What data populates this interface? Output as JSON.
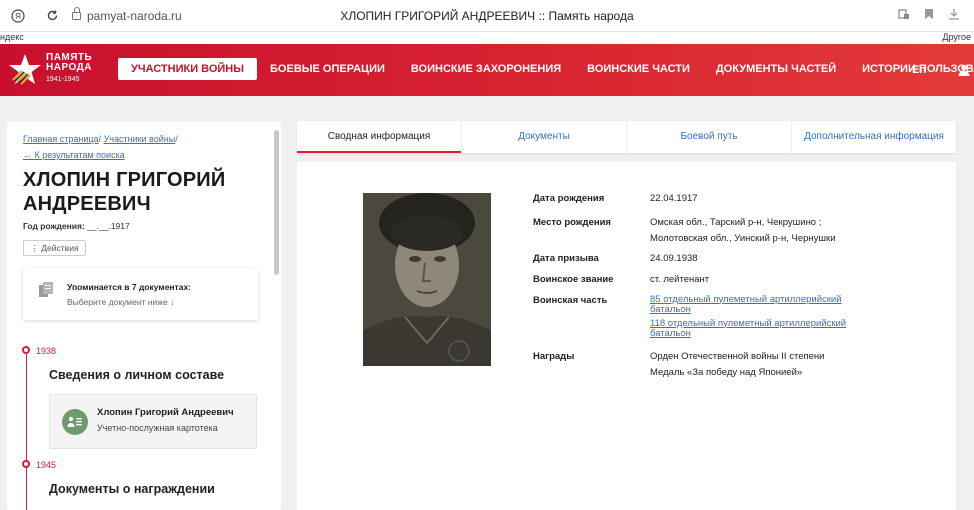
{
  "browser": {
    "url": "pamyat-naroda.ru",
    "page_title": "ХЛОПИН ГРИГОРИЙ АНДРЕЕВИЧ :: Память народа",
    "bookmark_left": "ндекс",
    "bookmark_right": "Другое"
  },
  "logo": {
    "line1": "ПАМЯТЬ",
    "line2": "НАРОДА",
    "line3": "1941-1945"
  },
  "nav": {
    "items": [
      "УЧАСТНИКИ ВОЙНЫ",
      "БОЕВЫЕ ОПЕРАЦИИ",
      "ВОИНСКИЕ ЗАХОРОНЕНИЯ",
      "ВОИНСКИЕ ЧАСТИ",
      "ДОКУМЕНТЫ ЧАСТЕЙ",
      "ИСТОРИИ ПОЛЬЗОВАТЕЛЕЙ"
    ],
    "lang": "En"
  },
  "sidebar": {
    "crumb_home": "Главная страница",
    "crumb_participants": "Участники войны",
    "back": "← К результатам поиска",
    "name": "ХЛОПИН ГРИГОРИЙ АНДРЕЕВИЧ",
    "birth_year_label": "Год рождения:",
    "birth_year_value": "__.__.1917",
    "actions": "⋮ Действия",
    "mention_title": "Упоминается в 7 документах:",
    "mention_sub": "Выберите документ ниже ↓",
    "timeline": [
      {
        "year": "1938",
        "heading": "Сведения о личном составе"
      },
      {
        "year": "1945",
        "heading": "Документы о награждении"
      }
    ],
    "record": {
      "name": "Хлопин Григорий Андреевич",
      "sub": "Учетно-послужная картотека"
    }
  },
  "tabs": [
    "Сводная информация",
    "Документы",
    "Боевой путь",
    "Дополнительная информация"
  ],
  "info": {
    "birth_date_label": "Дата рождения",
    "birth_date": "22.04.1917",
    "birth_place_label": "Место рождения",
    "birth_place_1": "Омская обл., Тарский р-н, Чекрушино ;",
    "birth_place_2": "Молотовская обл., Уинский р-н, Чернушки",
    "draft_date_label": "Дата призыва",
    "draft_date": "24.09.1938",
    "rank_label": "Воинское звание",
    "rank": "ст. лейтенант",
    "unit_label": "Воинская часть",
    "unit_1": "85 отдельный пулеметный артиллерийский батальон",
    "unit_2": "118 отдельный пулеметный артиллерийский батальон",
    "awards_label": "Награды",
    "award_1": "Орден Отечественной войны II степени",
    "award_2": "Медаль «За победу над Японией»"
  }
}
